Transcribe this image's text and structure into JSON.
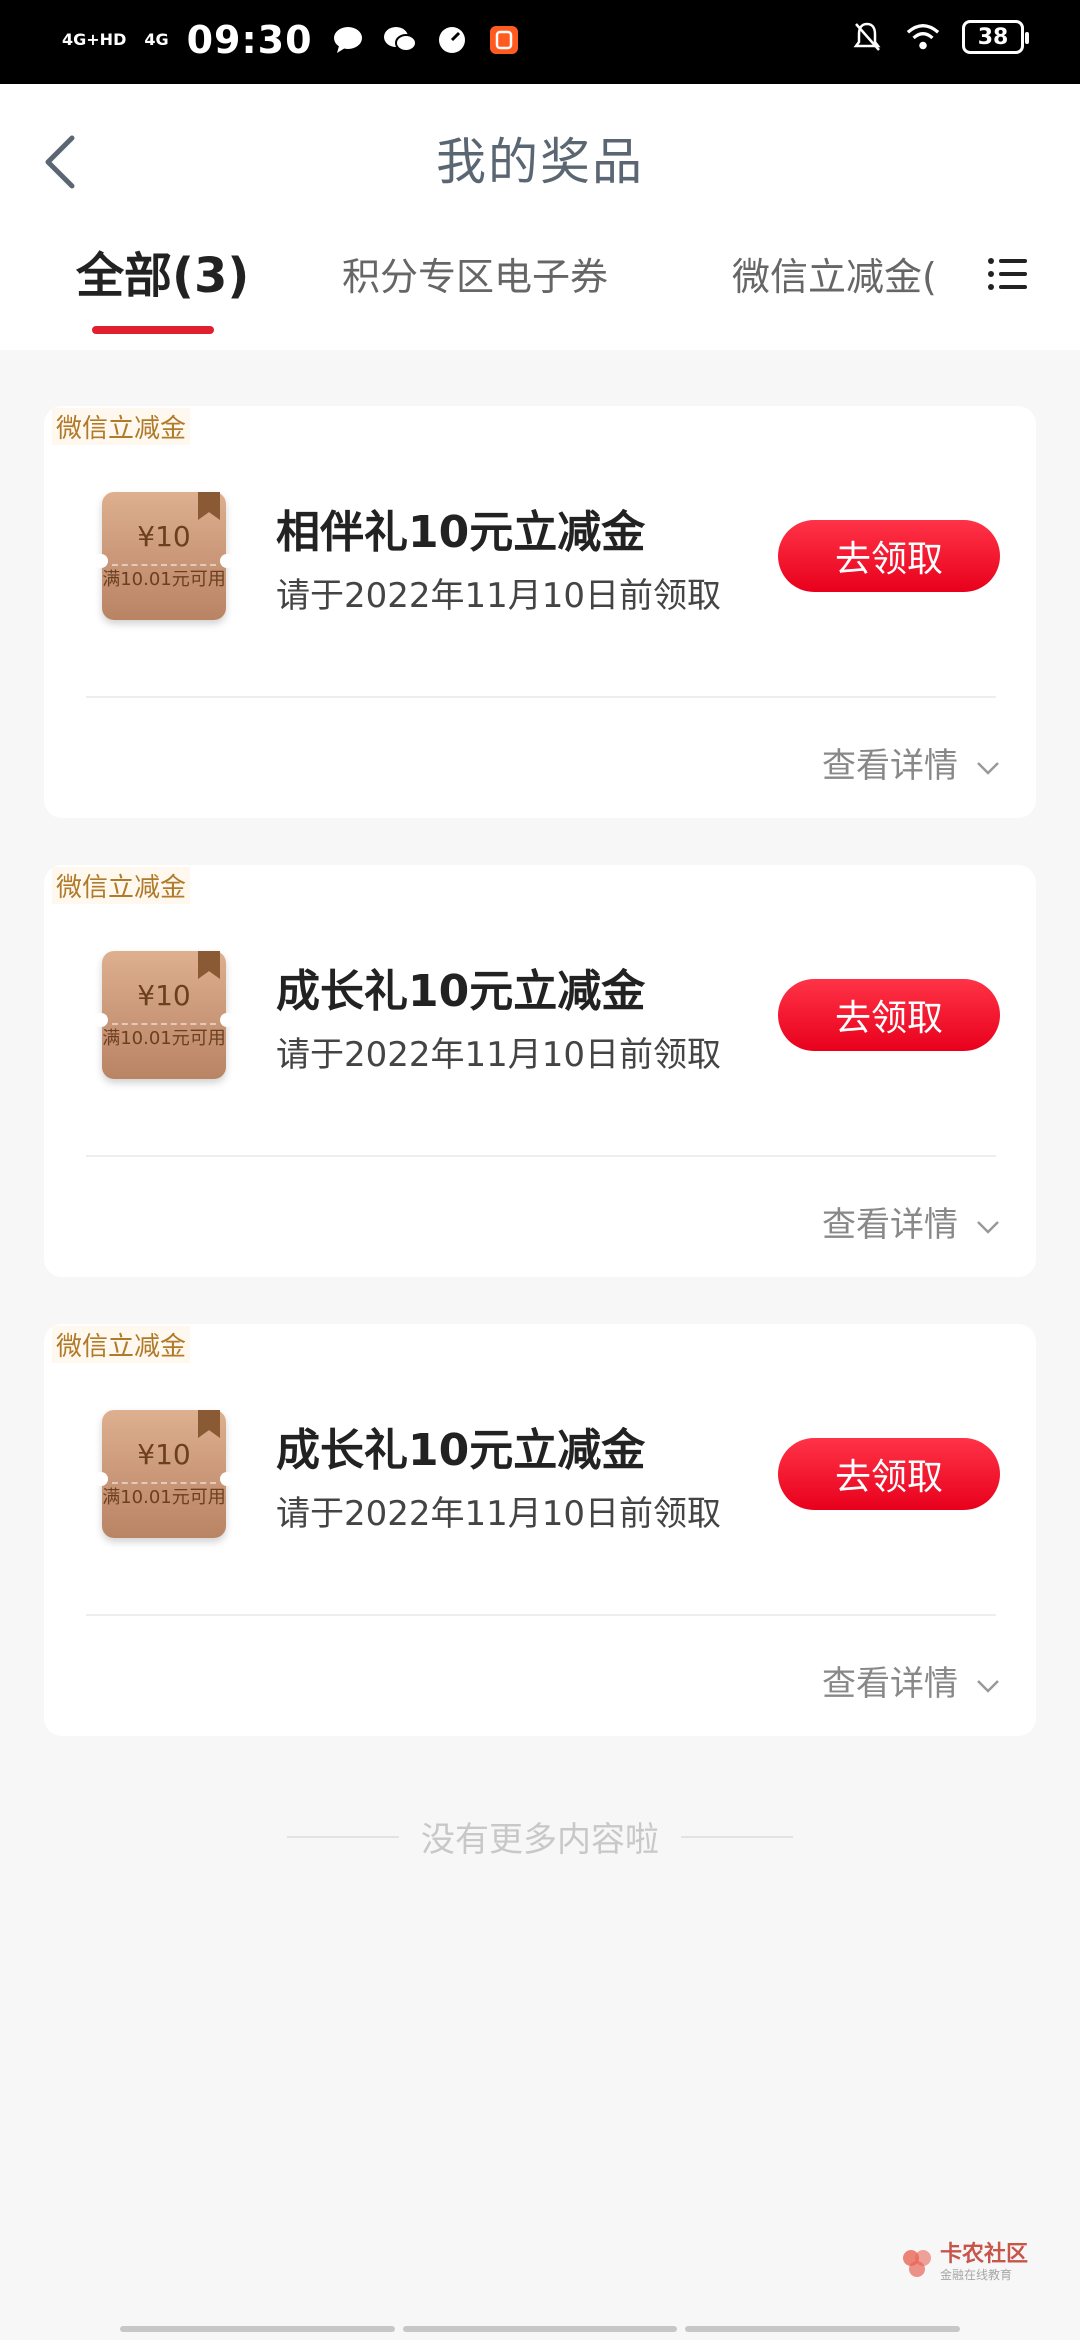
{
  "status_bar": {
    "network_1": "4G+HD",
    "network_2": "4G",
    "time": "09:30",
    "battery": "38"
  },
  "header": {
    "title": "我的奖品"
  },
  "tabs": [
    {
      "label": "全部(3)",
      "active": true
    },
    {
      "label": "积分专区电子券",
      "active": false
    },
    {
      "label": "微信立减金(",
      "active": false
    }
  ],
  "prizes": [
    {
      "tag": "微信立减金",
      "coupon_amount": "¥10",
      "coupon_condition": "满10.01元可用",
      "title": "相伴礼10元立减金",
      "subtitle": "请于2022年11月10日前领取",
      "button": "去领取",
      "details": "查看详情"
    },
    {
      "tag": "微信立减金",
      "coupon_amount": "¥10",
      "coupon_condition": "满10.01元可用",
      "title": "成长礼10元立减金",
      "subtitle": "请于2022年11月10日前领取",
      "button": "去领取",
      "details": "查看详情"
    },
    {
      "tag": "微信立减金",
      "coupon_amount": "¥10",
      "coupon_condition": "满10.01元可用",
      "title": "成长礼10元立减金",
      "subtitle": "请于2022年11月10日前领取",
      "button": "去领取",
      "details": "查看详情"
    }
  ],
  "footer": {
    "no_more": "没有更多内容啦"
  },
  "watermark": {
    "name": "卡农社区",
    "sub": "金融在线教育"
  },
  "colors": {
    "accent": "#e0202f",
    "button": "#ff1a30",
    "tag_text": "#b07a2a"
  }
}
